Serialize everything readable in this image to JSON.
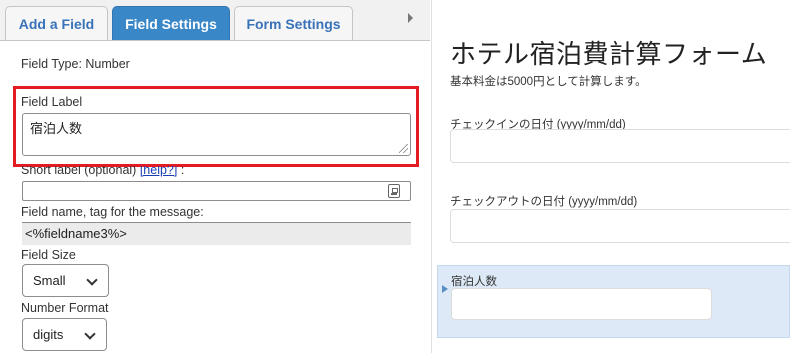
{
  "tabs": [
    {
      "label": "Add a Field",
      "active": false
    },
    {
      "label": "Field Settings",
      "active": true
    },
    {
      "label": "Form Settings",
      "active": false
    }
  ],
  "settings": {
    "field_type": "Field Type: Number",
    "field_label_heading": "Field Label",
    "field_label_value": "宿泊人数",
    "short_label_text": "Short label (optional) ",
    "short_label_help": "[help?]",
    "short_label_suffix": " :",
    "short_label_value": "",
    "field_name_heading": "Field name, tag for the message:",
    "field_name_value": "<%fieldname3%>",
    "field_size_heading": "Field Size",
    "field_size_value": "Small",
    "number_format_heading": "Number Format",
    "number_format_value": "digits"
  },
  "preview": {
    "title": "ホテル宿泊費計算フォーム",
    "description": "基本料金は5000円として計算します。",
    "fields": [
      {
        "label": "チェックインの日付 (yyyy/mm/dd)"
      },
      {
        "label": "チェックアウトの日付 (yyyy/mm/dd)"
      },
      {
        "label": "宿泊人数"
      }
    ]
  },
  "colors": {
    "active_tab": "#3a87c8",
    "tab_text": "#3872b8",
    "highlight_box": "#e31b23",
    "selected_field_bg": "#dde9f6"
  }
}
